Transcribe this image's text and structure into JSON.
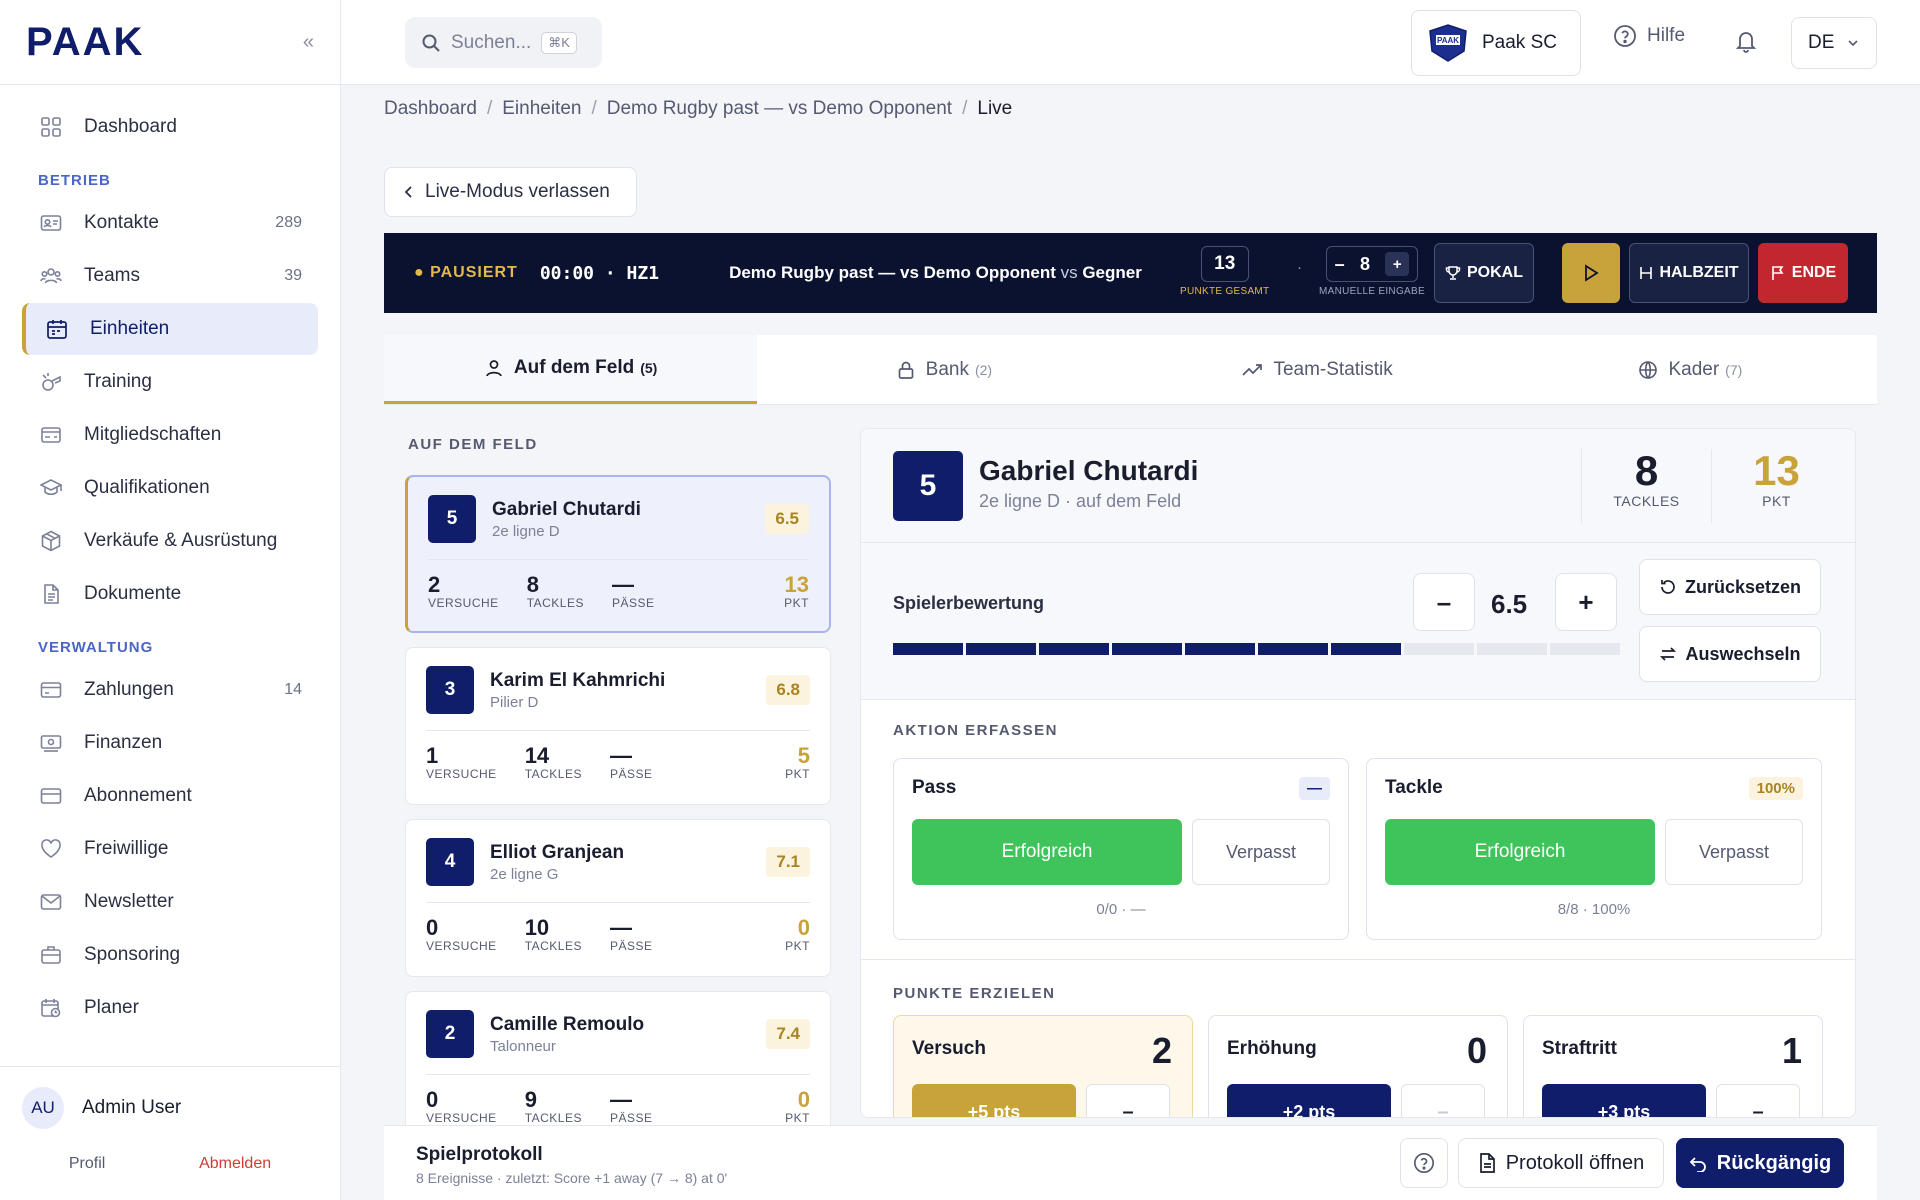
{
  "app": {
    "logo": "PAAK",
    "collapse_icon": "double-chevron-left-icon"
  },
  "sidebar": {
    "items": [
      {
        "label": "Dashboard",
        "icon": "grid-icon",
        "count": ""
      },
      {
        "label": "Kontakte",
        "icon": "contact-card-icon",
        "count": "289"
      },
      {
        "label": "Teams",
        "icon": "users-icon",
        "count": "39"
      },
      {
        "label": "Einheiten",
        "icon": "calendar-icon",
        "count": ""
      },
      {
        "label": "Training",
        "icon": "whistle-icon",
        "count": ""
      },
      {
        "label": "Mitgliedschaften",
        "icon": "membership-card-icon",
        "count": ""
      },
      {
        "label": "Qualifikationen",
        "icon": "graduation-cap-icon",
        "count": ""
      },
      {
        "label": "Verkäufe & Ausrüstung",
        "icon": "package-icon",
        "count": ""
      },
      {
        "label": "Dokumente",
        "icon": "document-icon",
        "count": ""
      },
      {
        "label": "Zahlungen",
        "icon": "credit-card-icon",
        "count": "14"
      },
      {
        "label": "Finanzen",
        "icon": "banknote-icon",
        "count": ""
      },
      {
        "label": "Abonnement",
        "icon": "subscription-card-icon",
        "count": ""
      },
      {
        "label": "Freiwillige",
        "icon": "heart-icon",
        "count": ""
      },
      {
        "label": "Newsletter",
        "icon": "mail-icon",
        "count": ""
      },
      {
        "label": "Sponsoring",
        "icon": "briefcase-icon",
        "count": ""
      },
      {
        "label": "Planer",
        "icon": "calendar-clock-icon",
        "count": ""
      }
    ],
    "section_betrieb": "BETRIEB",
    "section_verwaltung": "VERWALTUNG",
    "user": {
      "initials": "AU",
      "name": "Admin User",
      "profile": "Profil",
      "logout": "Abmelden"
    }
  },
  "topbar": {
    "search_placeholder": "Suchen...",
    "search_kbd": "⌘K",
    "club": "Paak SC",
    "help": "Hilfe",
    "lang": "DE"
  },
  "breadcrumb": {
    "b1": "Dashboard",
    "b2": "Einheiten",
    "b3": "Demo Rugby past — vs Demo Opponent",
    "b4": "Live"
  },
  "leave_label": "Live-Modus verlassen",
  "scorebar": {
    "status": "PAUSIERT",
    "time": "00:00",
    "half": "HZ1",
    "match": "Demo Rugby past — vs Demo Opponent",
    "vs": " vs ",
    "opponent": "Gegner",
    "total": "13",
    "total_label": "PUNKTE GESAMT",
    "manual_value": "8",
    "manual_minus": "–",
    "manual_plus": "+",
    "manual_label": "MANUELLE EINGABE",
    "pokal": "POKAL",
    "halbzeit": "HALBZEIT",
    "ende": "ENDE",
    "sep": "·",
    "dot": "·"
  },
  "tabs": [
    {
      "label": "Auf dem Feld",
      "count": "(5)"
    },
    {
      "label": "Bank",
      "count": "(2)"
    },
    {
      "label": "Team-Statistik",
      "count": ""
    },
    {
      "label": "Kader",
      "count": "(7)"
    }
  ],
  "field_title": "AUF DEM FELD",
  "stat_labels": {
    "versuche": "VERSUCHE",
    "tackles": "TACKLES",
    "passe": "PÄSSE",
    "pkt": "PKT"
  },
  "players": [
    {
      "num": "5",
      "name": "Gabriel Chutardi",
      "pos": "2e ligne D",
      "rating": "6.5",
      "versuche": "2",
      "tackles": "8",
      "passe": "—",
      "pkt": "13"
    },
    {
      "num": "3",
      "name": "Karim El Kahmrichi",
      "pos": "Pilier D",
      "rating": "6.8",
      "versuche": "1",
      "tackles": "14",
      "passe": "—",
      "pkt": "5"
    },
    {
      "num": "4",
      "name": "Elliot Granjean",
      "pos": "2e ligne G",
      "rating": "7.1",
      "versuche": "0",
      "tackles": "10",
      "passe": "—",
      "pkt": "0"
    },
    {
      "num": "2",
      "name": "Camille Remoulo",
      "pos": "Talonneur",
      "rating": "7.4",
      "versuche": "0",
      "tackles": "9",
      "passe": "—",
      "pkt": "0"
    }
  ],
  "detail": {
    "num": "5",
    "name": "Gabriel Chutardi",
    "pos": "2e ligne D · auf dem Feld",
    "tackles": "8",
    "tackles_label": "TACKLES",
    "pkt": "13",
    "pkt_label": "PKT",
    "rating_label": "Spielerbewertung",
    "rating": "6.5",
    "rating_fraction": 0.7,
    "minus": "–",
    "plus": "+",
    "reset": "Zurücksetzen",
    "swap": "Auswechseln",
    "action_title": "AKTION ERFASSEN",
    "pass": {
      "title": "Pass",
      "badge": "—",
      "ok": "Erfolgreich",
      "miss": "Verpasst",
      "sub": "0/0 · —"
    },
    "tackle": {
      "title": "Tackle",
      "badge": "100%",
      "ok": "Erfolgreich",
      "miss": "Verpasst",
      "sub": "8/8 · 100%"
    },
    "score_title": "PUNKTE ERZIELEN",
    "versuch": {
      "title": "Versuch",
      "count": "2",
      "plus": "+5 pts",
      "minus": "–"
    },
    "erhoehung": {
      "title": "Erhöhung",
      "count": "0",
      "plus": "+2 pts",
      "minus": "–"
    },
    "straftritt": {
      "title": "Straftritt",
      "count": "1",
      "plus": "+3 pts",
      "minus": "–"
    }
  },
  "bottombar": {
    "title": "Spielprotokoll",
    "sub": "8 Ereignisse · zuletzt: Score +1 away (7 → 8) at 0'",
    "open": "Protokoll öffnen",
    "undo": "Rückgängig"
  },
  "colors": {
    "navy": "#0f1d6b",
    "gold": "#c8a33a",
    "green": "#3ec45a",
    "red": "#c0282e",
    "scorebar": "#0b1230"
  }
}
